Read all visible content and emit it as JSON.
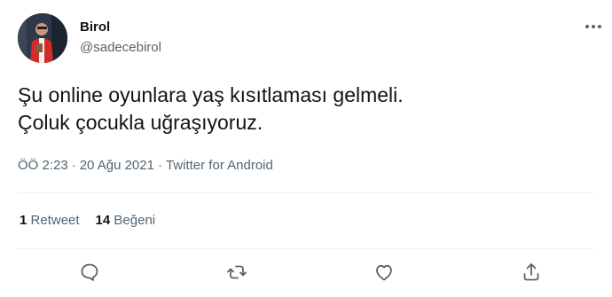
{
  "author": {
    "display_name": "Birol",
    "handle": "@sadecebirol",
    "avatar_icon": "profile-photo"
  },
  "tweet": {
    "lines": [
      "Şu online oyunlara yaş kısıtlaması gelmeli.",
      "Çoluk çocukla uğraşıyoruz."
    ]
  },
  "meta": {
    "time": "ÖÖ 2:23",
    "date": "20 Ağu 2021",
    "source": "Twitter for Android",
    "separator": "·"
  },
  "stats": {
    "retweet_count": "1",
    "retweet_label": "Retweet",
    "like_count": "14",
    "like_label": "Beğeni"
  },
  "actions": {
    "reply_icon": "reply-icon",
    "retweet_icon": "retweet-icon",
    "like_icon": "heart-icon",
    "share_icon": "share-icon"
  },
  "colors": {
    "text_primary": "#0f1419",
    "text_secondary": "#536471",
    "divider": "#eff3f4",
    "background": "#ffffff"
  }
}
